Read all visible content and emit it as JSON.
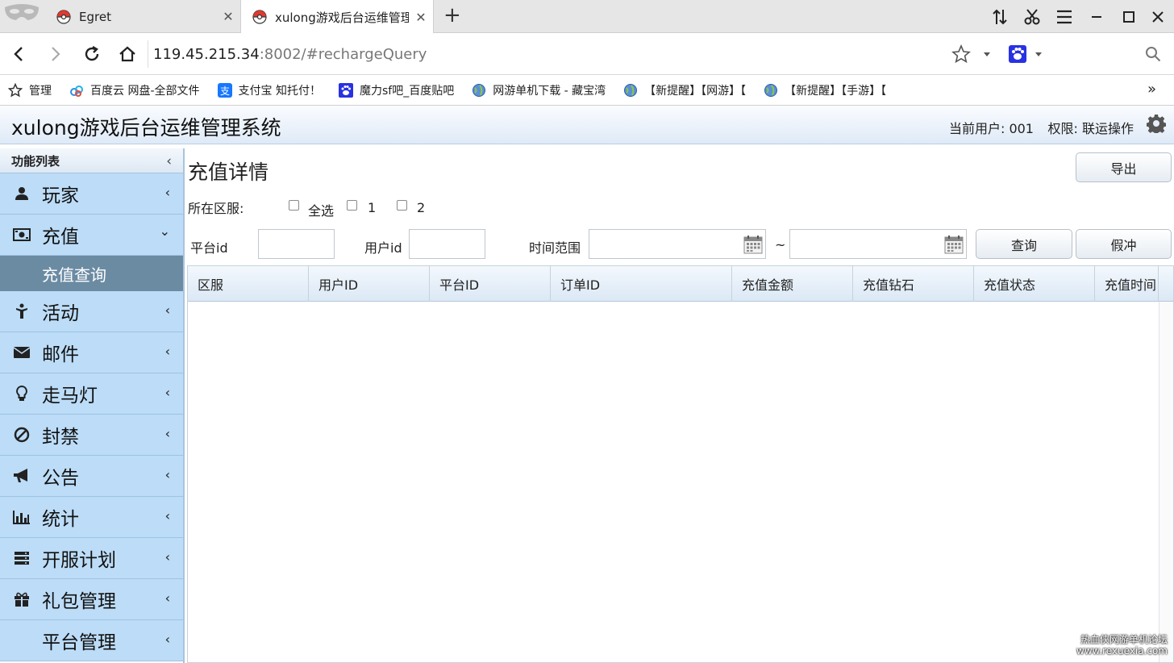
{
  "browser": {
    "tabs": [
      {
        "title": "Egret",
        "close": "✕"
      },
      {
        "title": "xulong游戏后台运维管理",
        "close": "✕"
      }
    ],
    "new_tab": "+",
    "url_host": "119.45.215.34",
    "url_rest": ":8002/#rechargeQuery",
    "bookmarks": [
      {
        "label": "管理",
        "icon": "star-icon"
      },
      {
        "label": "百度云 网盘-全部文件",
        "icon": "baidu-cloud-icon"
      },
      {
        "label": "支付宝 知托付！",
        "icon": "alipay-icon"
      },
      {
        "label": "魔力sf吧_百度贴吧",
        "icon": "baidu-paw-icon"
      },
      {
        "label": "网游单机下载 - 藏宝湾",
        "icon": "globe-icon"
      },
      {
        "label": "【新提醒】【网游】【",
        "icon": "globe-icon"
      },
      {
        "label": "【新提醒】【手游】【",
        "icon": "globe-icon"
      }
    ],
    "bookmarks_more": "»"
  },
  "header": {
    "title": "xulong游戏后台运维管理系统",
    "user": "当前用户: 001",
    "permission": "权限: 联运操作"
  },
  "sidebar": {
    "title": "功能列表",
    "items": [
      {
        "label": "玩家",
        "icon": "user-icon",
        "arrow": "‹"
      },
      {
        "label": "充值",
        "icon": "money-icon",
        "arrow": "⌄"
      },
      {
        "label": "活动",
        "icon": "activity-icon",
        "arrow": "‹"
      },
      {
        "label": "邮件",
        "icon": "mail-icon",
        "arrow": "‹"
      },
      {
        "label": "走马灯",
        "icon": "lightbulb-icon",
        "arrow": "‹"
      },
      {
        "label": "封禁",
        "icon": "ban-icon",
        "arrow": "‹"
      },
      {
        "label": "公告",
        "icon": "megaphone-icon",
        "arrow": "‹"
      },
      {
        "label": "统计",
        "icon": "bar-chart-icon",
        "arrow": "‹"
      },
      {
        "label": "开服计划",
        "icon": "server-icon",
        "arrow": "‹"
      },
      {
        "label": "礼包管理",
        "icon": "gift-icon",
        "arrow": "‹"
      },
      {
        "label": "平台管理",
        "icon": "",
        "arrow": "‹"
      }
    ],
    "subitem": "充值查询"
  },
  "main": {
    "title": "充值详情",
    "export_button": "导出",
    "zone_label": "所在区服:",
    "zone_options": [
      "全选",
      "1",
      "2"
    ],
    "platform_label": "平台id",
    "userid_label": "用户id",
    "time_label": "时间范围",
    "time_sep": "~",
    "query_button": "查询",
    "fake_button": "假冲",
    "columns": [
      "区服",
      "用户ID",
      "平台ID",
      "订单ID",
      "充值金额",
      "充值钻石",
      "充值状态",
      "充值时间"
    ]
  },
  "watermark": {
    "line1": "热血侠网游单机论坛",
    "line2": "www.rexuexia.com"
  }
}
